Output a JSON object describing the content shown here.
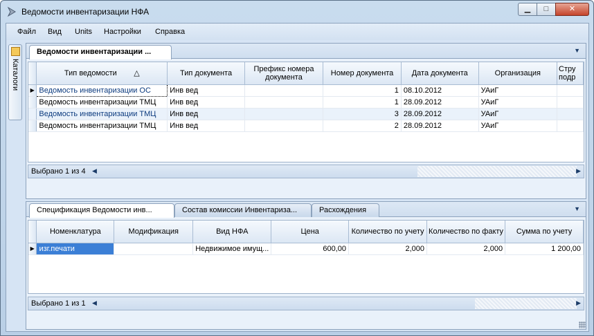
{
  "window": {
    "title": "Ведомости инвентаризации НФА",
    "min_glyph": "▁",
    "max_glyph": "□",
    "close_glyph": "✕"
  },
  "menu": [
    "Файл",
    "Вид",
    "Units",
    "Настройки",
    "Справка"
  ],
  "side_tab": {
    "label": "Каталоги"
  },
  "top_panel": {
    "tab": "Ведомости инвентаризации ...",
    "columns": [
      "Тип ведомости",
      "Тип документа",
      "Префикс номера документа",
      "Номер документа",
      "Дата документа",
      "Организация",
      "Стру подр"
    ],
    "sort_glyph": "△",
    "rows": [
      [
        "Ведомость инвентаризации ОС",
        "Инв вед",
        "",
        "1",
        "08.10.2012",
        "УАиГ",
        ""
      ],
      [
        "Ведомость инвентаризации ТМЦ",
        "Инв вед",
        "",
        "1",
        "28.09.2012",
        "УАиГ",
        ""
      ],
      [
        "Ведомость инвентаризации ТМЦ",
        "Инв вед",
        "",
        "3",
        "28.09.2012",
        "УАиГ",
        ""
      ],
      [
        "Ведомость инвентаризации ТМЦ",
        "Инв вед",
        "",
        "2",
        "28.09.2012",
        "УАиГ",
        ""
      ]
    ],
    "footer": "Выбрано 1 из 4"
  },
  "bottom_panel": {
    "tabs": [
      "Спецификация Ведомости инв...",
      "Состав комиссии Инвентариза...",
      "Расхождения"
    ],
    "columns": [
      "Номенклатура",
      "Модификация",
      "Вид НФА",
      "Цена",
      "Количество по учету",
      "Количество по факту",
      "Сумма по учету"
    ],
    "rows": [
      [
        "изг.печати",
        "",
        "Недвижимое имущ...",
        "600,00",
        "2,000",
        "2,000",
        "1 200,00"
      ]
    ],
    "footer": "Выбрано 1 из 1"
  },
  "glyphs": {
    "row_pointer": "▶",
    "arrow_left": "◀",
    "arrow_right": "▶",
    "dropdown": "▼"
  },
  "colors": {
    "selection": "#3b7fd6",
    "alt_row": "#eaf2fb",
    "close_button": "#c5452c"
  }
}
